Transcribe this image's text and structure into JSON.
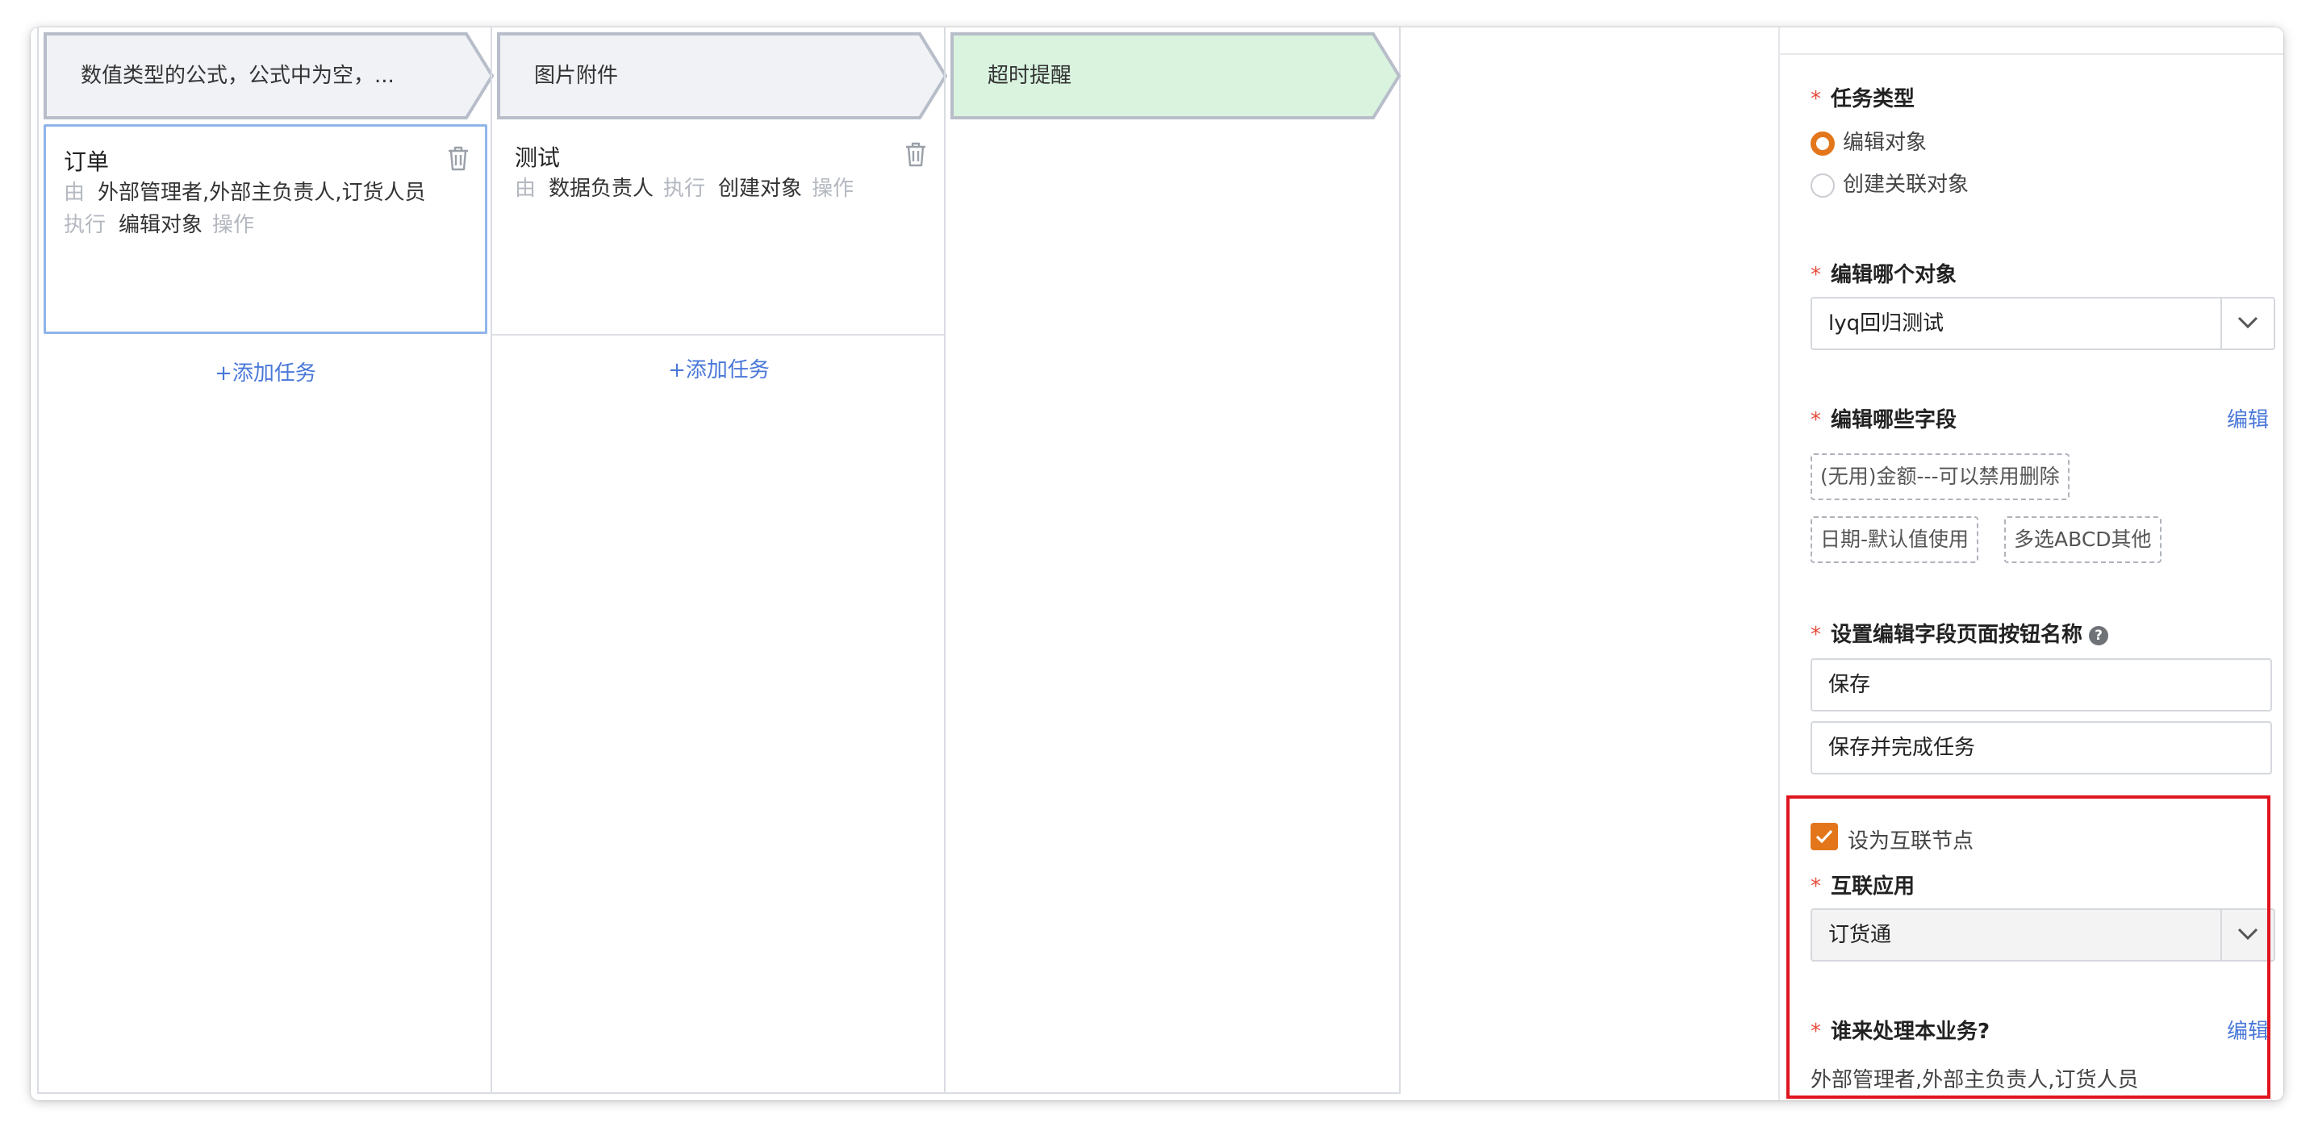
{
  "board": {
    "stages": [
      {
        "title": "数值类型的公式，公式中为空，...",
        "tasks": [
          {
            "name": "订单",
            "by_label": "由",
            "by": "外部管理者,外部主负责人,订货人员",
            "exec_label": "执行",
            "action": "编辑对象",
            "op_label": "操作"
          }
        ],
        "add_label": "+添加任务"
      },
      {
        "title": "图片附件",
        "tasks": [
          {
            "name": "测试",
            "by_label": "由",
            "by": "数据负责人",
            "exec_label": "执行",
            "action": "创建对象",
            "op_label": "操作"
          }
        ],
        "add_label": "+添加任务"
      },
      {
        "title": "超时提醒",
        "tasks": []
      }
    ],
    "colors": {
      "stage_fill": "#f0f2f6",
      "stage_border": "#b8bec9",
      "stage_active_fill": "#d9f3df",
      "accent": "#4a78d9"
    }
  },
  "panel": {
    "task_type": {
      "label": "任务类型",
      "options": [
        "编辑对象",
        "创建关联对象"
      ],
      "selected": "编辑对象"
    },
    "edit_object": {
      "label": "编辑哪个对象",
      "value": "lyq回归测试"
    },
    "edit_fields": {
      "label": "编辑哪些字段",
      "edit_label": "编辑",
      "tags": [
        "(无用)金额---可以禁用删除",
        "日期-默认值使用",
        "多选ABCD其他"
      ]
    },
    "button_names": {
      "label": "设置编辑字段页面按钮名称",
      "help": "?",
      "values": [
        "保存",
        "保存并完成任务"
      ]
    },
    "interconnect": {
      "checkbox_label": "设为互联节点",
      "checked": true,
      "app_label": "互联应用",
      "app_value": "订货通",
      "handler_label": "谁来处理本业务?",
      "handler_edit": "编辑",
      "handler_value": "外部管理者,外部主负责人,订货人员"
    },
    "required_mark": "*",
    "colors": {
      "required": "#e74c3c",
      "radio_on": "#e3761a",
      "highlight": "#e0141e"
    }
  }
}
